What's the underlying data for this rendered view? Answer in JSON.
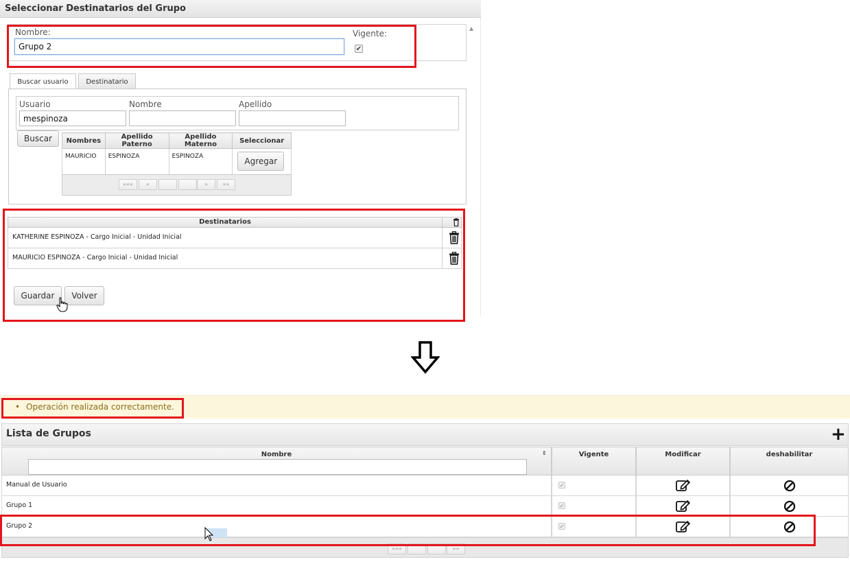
{
  "top": {
    "title": "Seleccionar Destinatarios del Grupo",
    "form": {
      "nombre_label": "Nombre:",
      "nombre_value": "Grupo 2",
      "vigente_label": "Vigente:",
      "vigente_checked": true
    },
    "tabs": [
      {
        "label": "Buscar usuario",
        "active": true
      },
      {
        "label": "Destinatario",
        "active": false
      }
    ],
    "search": {
      "usuario_label": "Usuario",
      "usuario_value": "mespinoza",
      "nombre_label": "Nombre",
      "nombre_value": "",
      "apellido_label": "Apellido",
      "apellido_value": "",
      "buscar_label": "Buscar"
    },
    "results": {
      "headers": [
        "Nombres",
        "Apellido Paterno",
        "Apellido Materno",
        "Seleccionar"
      ],
      "rows": [
        {
          "nombres": "MAURICIO",
          "paterno": "ESPINOZA",
          "materno": "ESPINOZA",
          "action": "Agregar"
        }
      ],
      "pager": [
        "«««",
        "«",
        "",
        "",
        "»",
        "»»"
      ]
    },
    "destinatarios": {
      "header": "Destinatarios",
      "rows": [
        "KATHERINE ESPINOZA - Cargo Inicial - Unidad Inicial",
        "MAURICIO ESPINOZA - Cargo Inicial - Unidad Inicial"
      ]
    },
    "buttons": {
      "guardar": "Guardar",
      "volver": "Volver"
    }
  },
  "arrow_icon": "down-arrow-icon",
  "bottom": {
    "message": "Operación realizada correctamente.",
    "list_title": "Lista de Grupos",
    "columns": [
      "Nombre",
      "Vigente",
      "Modificar",
      "deshabilitar"
    ],
    "filter_value": "",
    "rows": [
      {
        "nombre": "Manual de Usuario",
        "vigente": true
      },
      {
        "nombre": "Grupo 1",
        "vigente": true
      },
      {
        "nombre": "Grupo 2",
        "vigente": true
      }
    ],
    "pager": [
      "«««",
      "",
      "",
      "»»"
    ]
  },
  "colors": {
    "highlight": "#e3151b",
    "message_bg": "#fcf7dc",
    "message_text": "#8a6d1f"
  }
}
